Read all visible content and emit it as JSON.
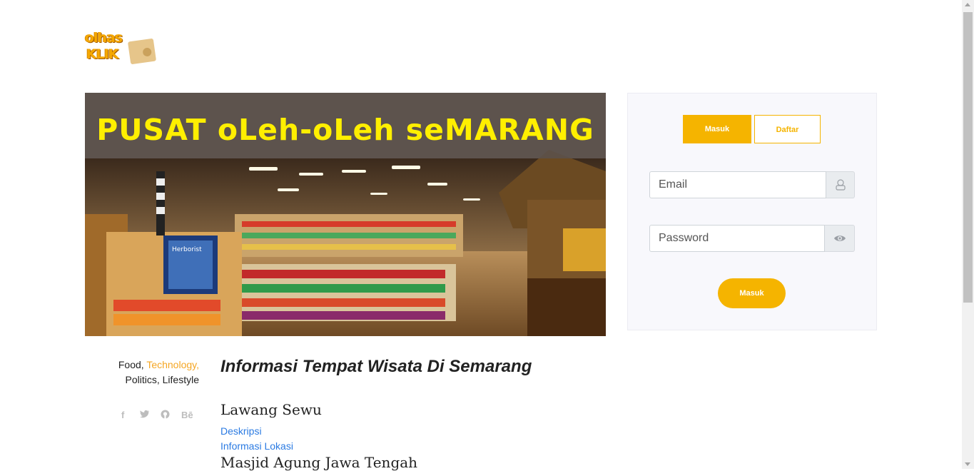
{
  "logo": {
    "line1": "olhas",
    "line2": "KLIK"
  },
  "hero": {
    "banner_text": "PUSAT oLeh-oLeh seMARANG",
    "sign_text": "Herborist"
  },
  "login": {
    "tab_login": "Masuk",
    "tab_register": "Daftar",
    "email_placeholder": "Email",
    "password_placeholder": "Password",
    "submit_label": "Masuk",
    "email_icon": "user-icon",
    "password_icon": "eye-icon"
  },
  "meta": {
    "categories": [
      {
        "label": "Food",
        "sep": ", "
      },
      {
        "label": "Technology,",
        "sep": ""
      },
      {
        "label": "Politics",
        "sep": ", "
      },
      {
        "label": "Lifestyle",
        "sep": ""
      }
    ],
    "social": [
      "facebook-icon",
      "twitter-icon",
      "github-icon",
      "behance-icon"
    ]
  },
  "article": {
    "title": "Informasi Tempat Wisata Di Semarang",
    "places": [
      {
        "name": "Lawang Sewu",
        "links": [
          "Deskripsi",
          "Informasi Lokasi"
        ]
      },
      {
        "name": "Masjid Agung Jawa Tengah"
      }
    ]
  },
  "colors": {
    "accent": "#f5b400",
    "link": "#2a7ae2"
  }
}
